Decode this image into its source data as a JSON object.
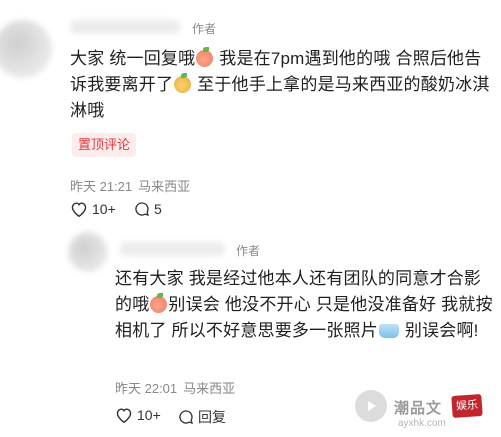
{
  "comments": [
    {
      "author_tag": "作者",
      "text_parts": [
        "大家 统一回复哦",
        " 我是在7pm遇到他的哦 合照后他告诉我要离开了",
        " 至于他手上拿的是马来西亚的酸奶冰淇淋哦"
      ],
      "pin_label": "置顶评论",
      "time": "昨天 21:21",
      "location": "马来西亚",
      "likes": "10+",
      "replies": "5"
    },
    {
      "author_tag": "作者",
      "text_parts": [
        "还有大家 我是经过他本人还有团队的同意才合影的哦",
        "别误会 他没不开心 只是他没准备好 我就按相机了 所以不好意思要多一张照片",
        " 别误会啊!"
      ],
      "time": "昨天 22:01",
      "location": "马来西亚",
      "likes": "10+",
      "reply_label": "回复"
    }
  ],
  "watermark": {
    "text": "潮品文",
    "url": "ayxhk.com",
    "seal": "娱乐"
  },
  "icons": [
    "heart-icon",
    "comment-icon",
    "play-icon"
  ]
}
